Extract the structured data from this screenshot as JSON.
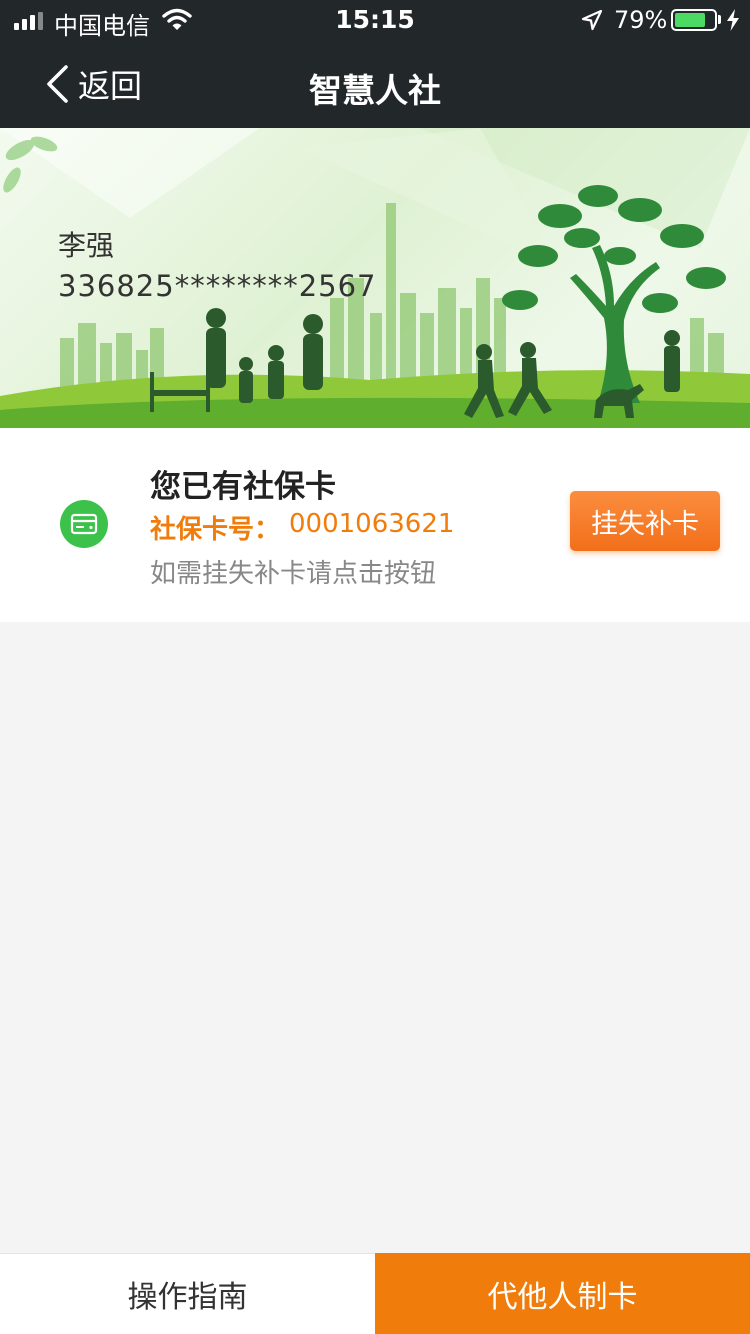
{
  "status_bar": {
    "carrier": "中国电信",
    "time": "15:15",
    "battery_percent": "79%",
    "battery_level": 0.79,
    "icons": [
      "signal-icon",
      "wifi-icon",
      "location-arrow-icon",
      "battery-icon",
      "charging-bolt-icon"
    ]
  },
  "nav": {
    "back_label": "返回",
    "title": "智慧人社"
  },
  "card_holder": {
    "name": "李强",
    "id_number": "336825********2567"
  },
  "card_info": {
    "title": "您已有社保卡",
    "card_number_label": "社保卡号：",
    "card_number": "0001063621",
    "tip": "如需挂失补卡请点击按钮",
    "report_button": "挂失补卡",
    "icon": "card-icon"
  },
  "bottom_bar": {
    "guide_label": "操作指南",
    "make_card_label": "代他人制卡"
  },
  "colors": {
    "nav_bg": "#22282a",
    "accent_orange": "#f07c0b",
    "icon_green": "#3cc24a",
    "page_bg": "#f4f4f4",
    "battery_green": "#4cd964"
  }
}
